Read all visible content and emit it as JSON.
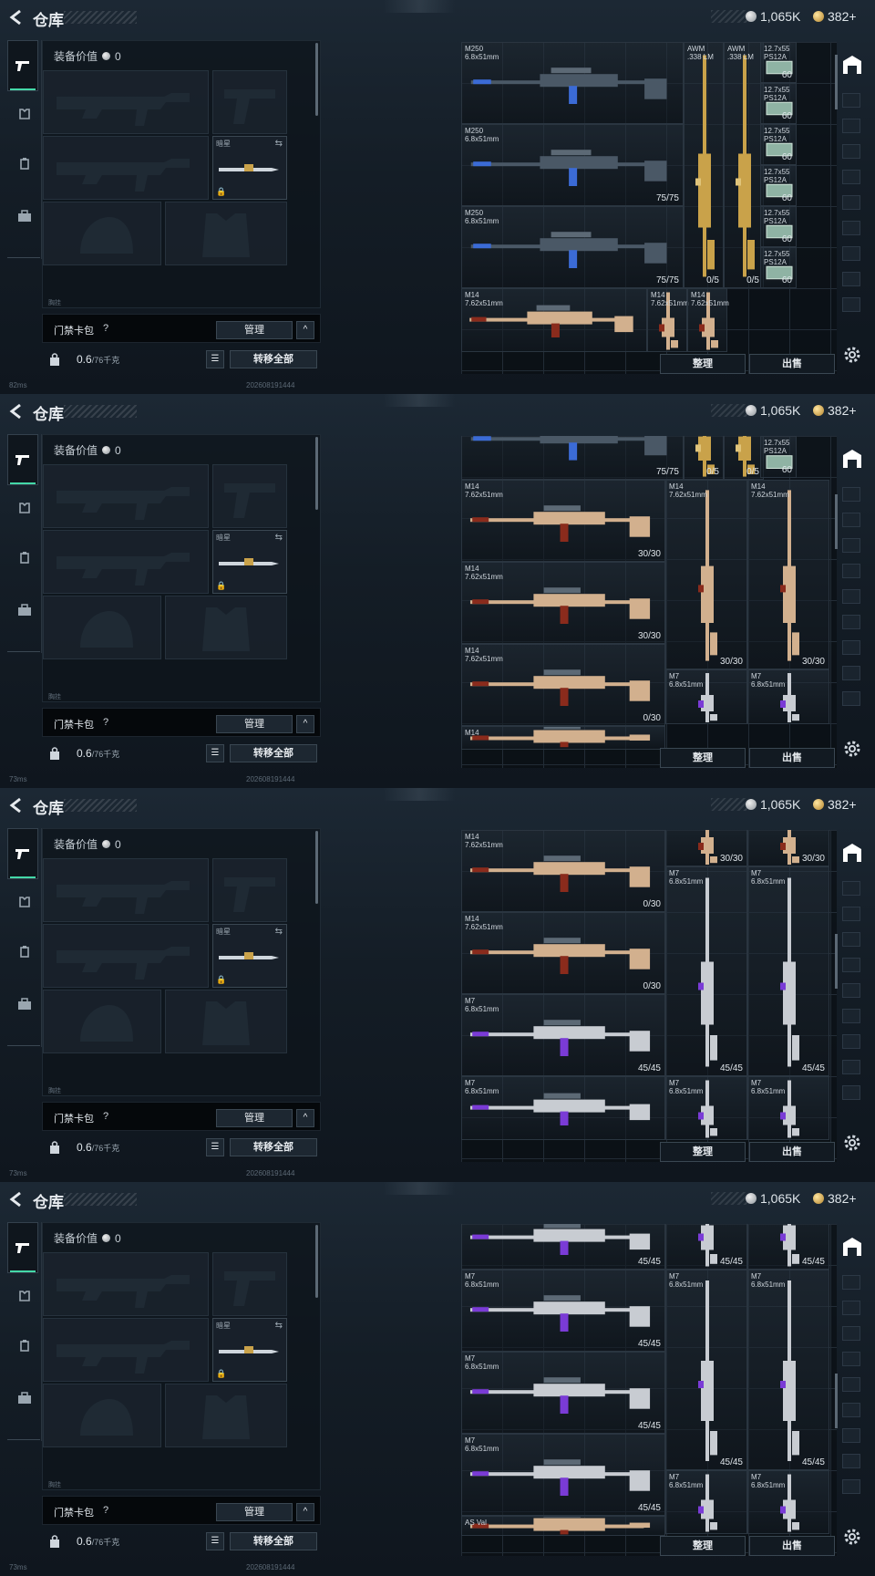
{
  "header": {
    "title": "仓库",
    "currency_silver": "1,065K",
    "currency_gold": "382+"
  },
  "left_nav": {
    "items": [
      "weapons",
      "armor",
      "backpack",
      "keys"
    ]
  },
  "equipment": {
    "value_label": "装备价值",
    "value_amount": "0",
    "knife_tag": "暗星",
    "sub_label": "胸挂"
  },
  "keycard": {
    "label": "门禁卡包",
    "help": "?",
    "manage_label": "管理",
    "chevron": "^"
  },
  "weight": {
    "current": "0.6",
    "max": "/76千克",
    "move_all_label": "转移全部"
  },
  "status": {
    "ping_values": [
      "82ms",
      "73ms",
      "73ms",
      "73ms"
    ],
    "build": "202608191444"
  },
  "inventory": {
    "sort_label": "整理",
    "sell_label": "出售"
  },
  "panels": [
    {
      "items": [
        {
          "name": "M250",
          "caliber": "6.8x51mm",
          "ammo": "",
          "kind": "hmg"
        },
        {
          "name": "M250",
          "caliber": "6.8x51mm",
          "ammo": "75/75",
          "kind": "hmg"
        },
        {
          "name": "M250",
          "caliber": "6.8x51mm",
          "ammo": "75/75",
          "kind": "hmg"
        },
        {
          "name": "AWM",
          "caliber": ".338 LM",
          "ammo": "0/5",
          "kind": "sniper"
        },
        {
          "name": "AWM",
          "caliber": ".338 LM",
          "ammo": "0/5",
          "kind": "sniper"
        },
        {
          "name": "M14",
          "caliber": "7.62x51mm",
          "ammo": "",
          "kind": "dmr"
        },
        {
          "name": "M14",
          "caliber": "7.62x51mm",
          "ammo": "",
          "kind": "dmr-v"
        },
        {
          "name": "M14",
          "caliber": "7.62x51mm",
          "ammo": "",
          "kind": "dmr-v"
        },
        {
          "name": "12.7x55",
          "caliber": "PS12A",
          "ammo": "60",
          "kind": "ammo"
        },
        {
          "name": "12.7x55",
          "caliber": "PS12A",
          "ammo": "60",
          "kind": "ammo"
        },
        {
          "name": "12.7x55",
          "caliber": "PS12A",
          "ammo": "60",
          "kind": "ammo"
        },
        {
          "name": "12.7x55",
          "caliber": "PS12A",
          "ammo": "60",
          "kind": "ammo"
        },
        {
          "name": "12.7x55",
          "caliber": "PS12A",
          "ammo": "60",
          "kind": "ammo"
        },
        {
          "name": "12.7x55",
          "caliber": "PS12A",
          "ammo": "60",
          "kind": "ammo"
        }
      ]
    },
    {
      "items": [
        {
          "name": "",
          "caliber": "",
          "ammo": "75/75",
          "kind": "hmg"
        },
        {
          "name": "",
          "caliber": "",
          "ammo": "0/5",
          "kind": "sniper"
        },
        {
          "name": "",
          "caliber": "",
          "ammo": "0/5",
          "kind": "sniper"
        },
        {
          "name": "12.7x55",
          "caliber": "PS12A",
          "ammo": "60",
          "kind": "ammo"
        },
        {
          "name": "M14",
          "caliber": "7.62x51mm",
          "ammo": "30/30",
          "kind": "dmr"
        },
        {
          "name": "M14",
          "caliber": "7.62x51mm",
          "ammo": "30/30",
          "kind": "dmr"
        },
        {
          "name": "M14",
          "caliber": "7.62x51mm",
          "ammo": "0/30",
          "kind": "dmr"
        },
        {
          "name": "M14",
          "caliber": "7.62x51mm",
          "ammo": "30/30",
          "kind": "dmr-v"
        },
        {
          "name": "M14",
          "caliber": "7.62x51mm",
          "ammo": "30/30",
          "kind": "dmr-v"
        },
        {
          "name": "M7",
          "caliber": "6.8x51mm",
          "ammo": "",
          "kind": "ar-v"
        },
        {
          "name": "M7",
          "caliber": "6.8x51mm",
          "ammo": "",
          "kind": "ar-v"
        },
        {
          "name": "M14",
          "caliber": "",
          "ammo": "",
          "kind": "dmr"
        }
      ]
    },
    {
      "items": [
        {
          "name": "",
          "caliber": "",
          "ammo": "30/30",
          "kind": "dmr-v"
        },
        {
          "name": "",
          "caliber": "",
          "ammo": "30/30",
          "kind": "dmr-v"
        },
        {
          "name": "M14",
          "caliber": "7.62x51mm",
          "ammo": "0/30",
          "kind": "dmr"
        },
        {
          "name": "M14",
          "caliber": "7.62x51mm",
          "ammo": "0/30",
          "kind": "dmr"
        },
        {
          "name": "M7",
          "caliber": "6.8x51mm",
          "ammo": "45/45",
          "kind": "ar"
        },
        {
          "name": "M7",
          "caliber": "6.8x51mm",
          "ammo": "",
          "kind": "ar"
        },
        {
          "name": "M7",
          "caliber": "6.8x51mm",
          "ammo": "45/45",
          "kind": "ar-v"
        },
        {
          "name": "M7",
          "caliber": "6.8x51mm",
          "ammo": "45/45",
          "kind": "ar-v"
        },
        {
          "name": "M7",
          "caliber": "6.8x51mm",
          "ammo": "",
          "kind": "ar-v"
        },
        {
          "name": "M7",
          "caliber": "6.8x51mm",
          "ammo": "",
          "kind": "ar-v"
        },
        {
          "name": "",
          "caliber": "",
          "ammo": "30/30",
          "kind": "dmr"
        }
      ]
    },
    {
      "items": [
        {
          "name": "",
          "caliber": "",
          "ammo": "45/45",
          "kind": "ar"
        },
        {
          "name": "",
          "caliber": "",
          "ammo": "45/45",
          "kind": "ar-v"
        },
        {
          "name": "",
          "caliber": "",
          "ammo": "45/45",
          "kind": "ar-v"
        },
        {
          "name": "M7",
          "caliber": "6.8x51mm",
          "ammo": "45/45",
          "kind": "ar"
        },
        {
          "name": "M7",
          "caliber": "6.8x51mm",
          "ammo": "45/45",
          "kind": "ar"
        },
        {
          "name": "M7",
          "caliber": "6.8x51mm",
          "ammo": "45/45",
          "kind": "ar"
        },
        {
          "name": "M7",
          "caliber": "6.8x51mm",
          "ammo": "45/45",
          "kind": "ar-v"
        },
        {
          "name": "M7",
          "caliber": "6.8x51mm",
          "ammo": "45/45",
          "kind": "ar-v"
        },
        {
          "name": "M7",
          "caliber": "6.8x51mm",
          "ammo": "",
          "kind": "ar-v"
        },
        {
          "name": "M7",
          "caliber": "6.8x51mm",
          "ammo": "",
          "kind": "ar-v"
        },
        {
          "name": "AS Val",
          "caliber": "",
          "ammo": "",
          "kind": "dmr"
        }
      ]
    }
  ],
  "colors": {
    "accent_green": "#44d8a8",
    "purple_accent": "#7a3bd6",
    "gold_accent": "#c9a24a"
  }
}
